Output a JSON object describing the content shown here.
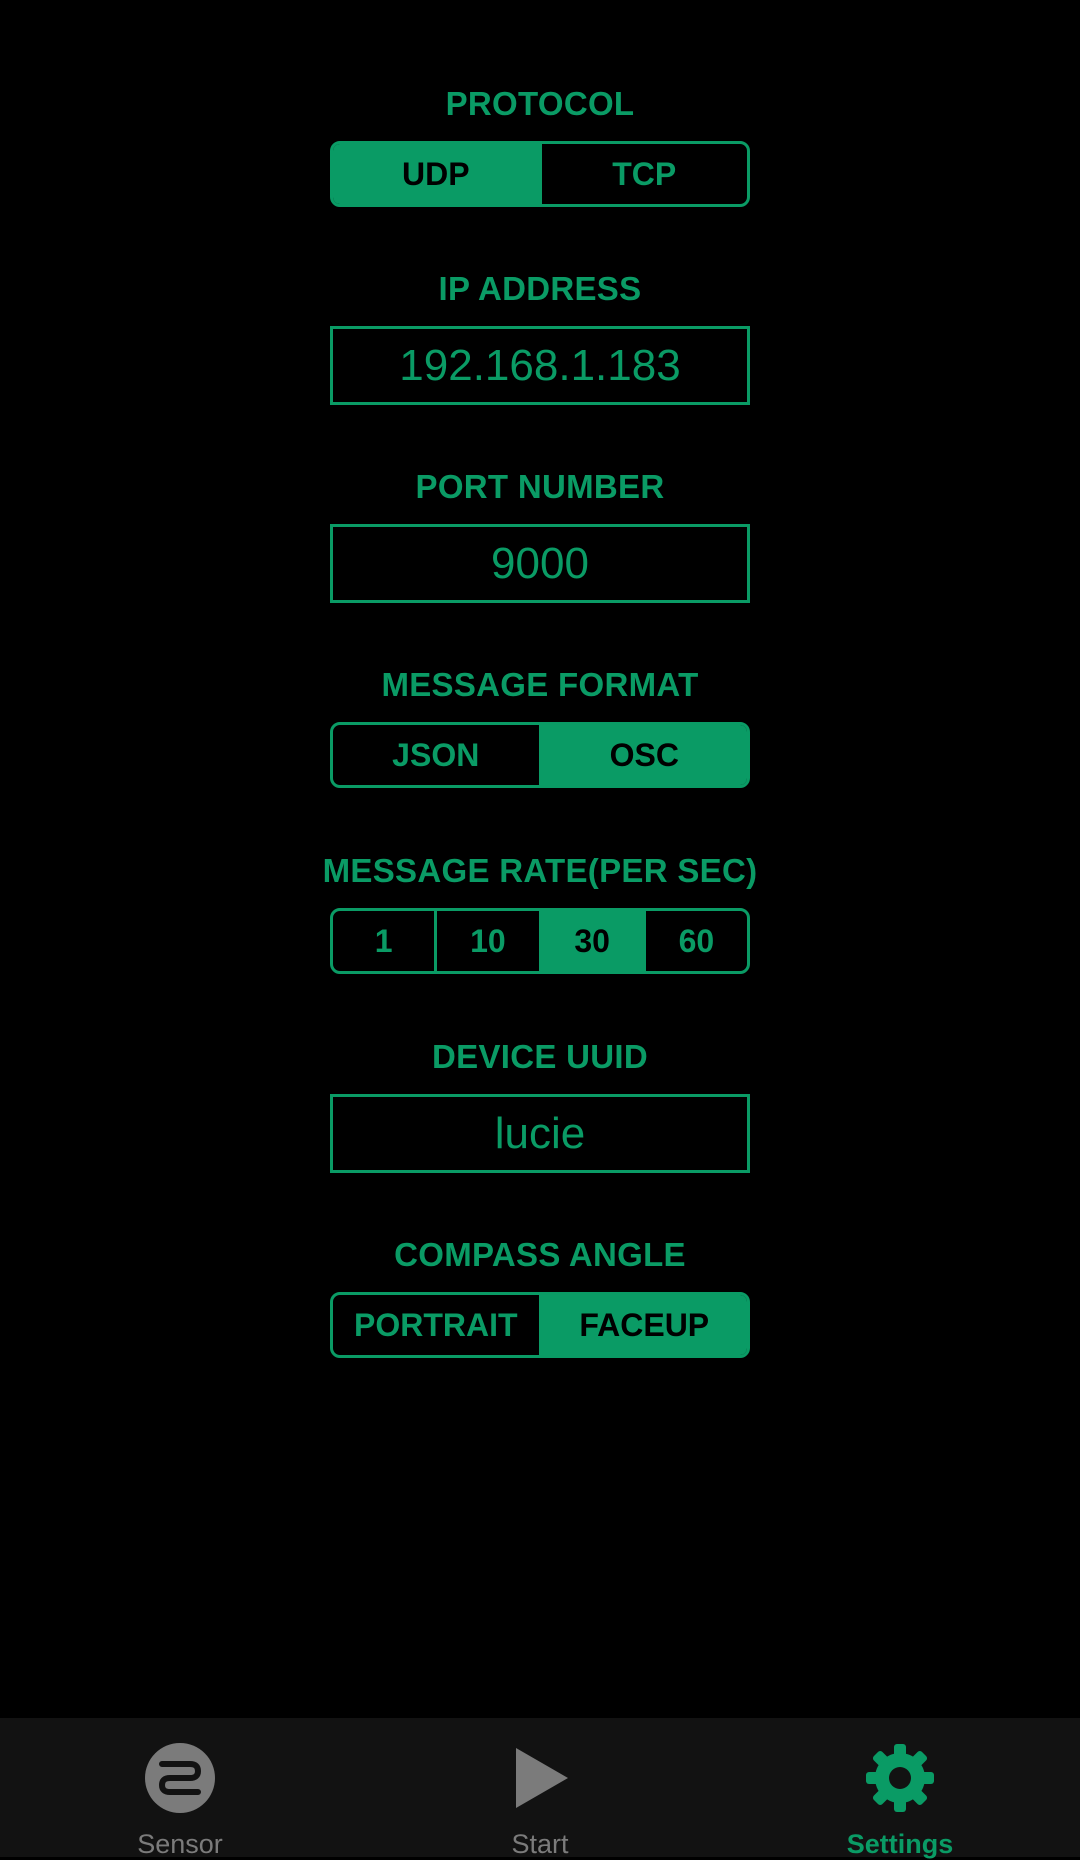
{
  "colors": {
    "accent": "#0A9B65",
    "background": "#000000",
    "nav_background": "#121212",
    "inactive_nav": "#7B7B7B"
  },
  "protocol": {
    "label": "PROTOCOL",
    "options": [
      "UDP",
      "TCP"
    ],
    "selected": "UDP"
  },
  "ip_address": {
    "label": "IP ADDRESS",
    "value": "192.168.1.183"
  },
  "port_number": {
    "label": "PORT NUMBER",
    "value": "9000"
  },
  "message_format": {
    "label": "MESSAGE FORMAT",
    "options": [
      "JSON",
      "OSC"
    ],
    "selected": "OSC"
  },
  "message_rate": {
    "label": "MESSAGE RATE(PER SEC)",
    "options": [
      "1",
      "10",
      "30",
      "60"
    ],
    "selected": "30"
  },
  "device_uuid": {
    "label": "DEVICE UUID",
    "value": "lucie"
  },
  "compass_angle": {
    "label": "COMPASS ANGLE",
    "options": [
      "PORTRAIT",
      "FACEUP"
    ],
    "selected": "FACEUP"
  },
  "bottom_nav": {
    "items": [
      {
        "label": "Sensor",
        "icon": "sensor-icon",
        "active": false
      },
      {
        "label": "Start",
        "icon": "play-icon",
        "active": false
      },
      {
        "label": "Settings",
        "icon": "gear-icon",
        "active": true
      }
    ]
  }
}
